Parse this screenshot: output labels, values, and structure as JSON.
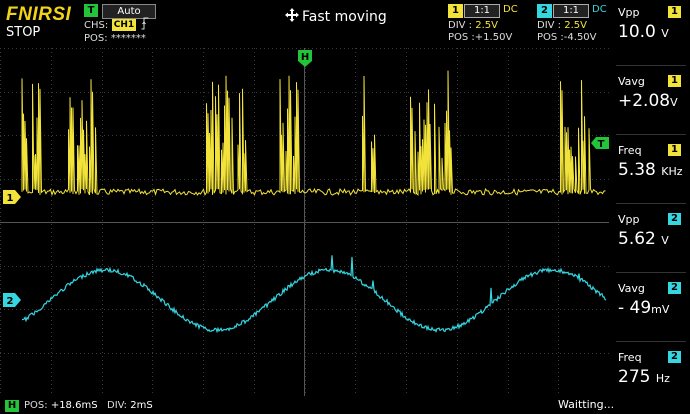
{
  "header": {
    "brand": "FNIRSI",
    "run_state": "STOP",
    "trigger": {
      "badge": "T",
      "mode": "Auto",
      "source_label": "CHS:",
      "source_badge": "CH1",
      "edge_icon": "rising-edge-icon",
      "pos_label": "POS:",
      "pos_value": "*******"
    },
    "mode_text": "Fast moving",
    "mode_icon": "move-cross-icon",
    "ch1": {
      "num": "1",
      "probe": "1:1",
      "coupling": "DC",
      "div_label": "DIV :",
      "div_value": "2.5V",
      "pos_label": "POS :",
      "pos_value": "+1.50V"
    },
    "ch2": {
      "num": "2",
      "probe": "1:1",
      "coupling": "DC",
      "div_label": "DIV :",
      "div_value": "2.5V",
      "pos_label": "POS :",
      "pos_value": "-4.50V"
    }
  },
  "markers": {
    "horizontal": "H",
    "trigger_level": "T",
    "ch1": "1",
    "ch2": "2"
  },
  "measurements": [
    {
      "label": "Vpp",
      "channel": "1",
      "value": "10.0",
      "unit": "V"
    },
    {
      "label": "Vavg",
      "channel": "1",
      "value": "+2.08",
      "unit": "V"
    },
    {
      "label": "Freq",
      "channel": "1",
      "value": "5.38",
      "unit": "KHz"
    },
    {
      "label": "Vpp",
      "channel": "2",
      "value": "5.62",
      "unit": "V"
    },
    {
      "label": "Vavg",
      "channel": "2",
      "value": "- 49",
      "unit": "mV"
    },
    {
      "label": "Freq",
      "channel": "2",
      "value": "275",
      "unit": "Hz"
    }
  ],
  "footer": {
    "h_badge": "H",
    "pos_label": "POS:",
    "pos_value": "+18.6mS",
    "div_label": "DIV:",
    "div_value": "2mS",
    "status": "Waitting..."
  },
  "colors": {
    "ch1": "#f2e33a",
    "ch2": "#35d6e0",
    "accent": "#23c33a",
    "grid": "#3a3a3a"
  }
}
